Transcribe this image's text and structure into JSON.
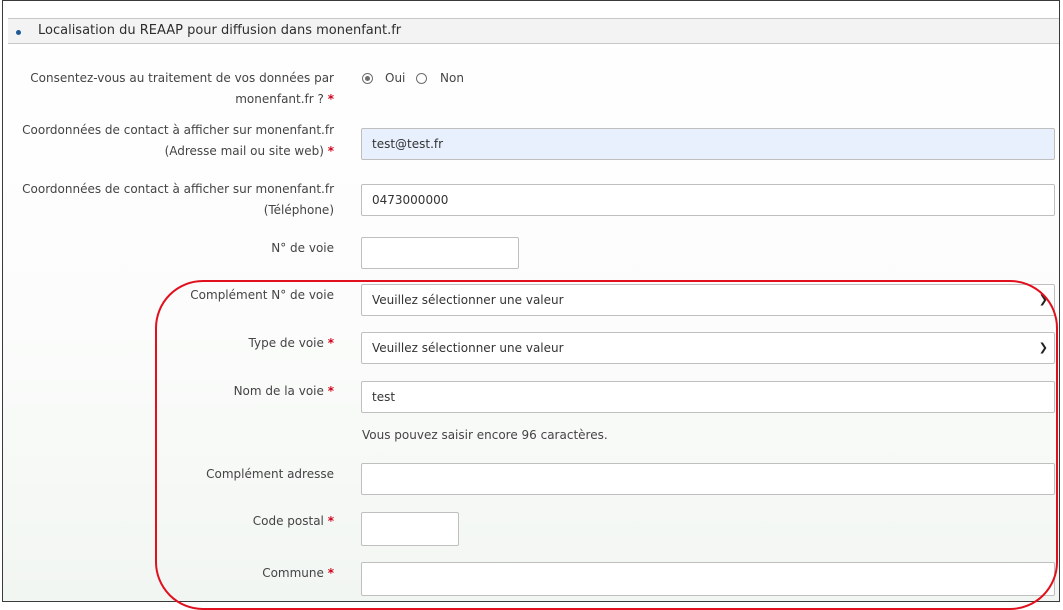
{
  "section": {
    "title": "Localisation du REAAP pour diffusion dans monenfant.fr"
  },
  "consent": {
    "label_line1": "Consentez-vous au traitement de vos données par",
    "label_line2": "monenfant.fr ?",
    "options": [
      "Oui",
      "Non"
    ],
    "selected": "Oui"
  },
  "contact_email": {
    "label_line1": "Coordonnées de contact à afficher sur monenfant.fr",
    "label_line2": "(Adresse mail ou site web)",
    "value": "test@test.fr"
  },
  "contact_phone": {
    "label_line1": "Coordonnées de contact à afficher sur monenfant.fr",
    "label_line2": "(Téléphone)",
    "value": "0473000000"
  },
  "street_number": {
    "label": "N° de voie",
    "value": ""
  },
  "street_number_complement": {
    "label": "Complément N° de voie",
    "selected": "Veuillez sélectionner une valeur"
  },
  "street_type": {
    "label": "Type de voie",
    "selected": "Veuillez sélectionner une valeur"
  },
  "street_name": {
    "label": "Nom de la voie",
    "value": "test",
    "hint": "Vous pouvez saisir encore 96 caractères."
  },
  "address_complement": {
    "label": "Complément adresse",
    "value": ""
  },
  "postal_code": {
    "label": "Code postal",
    "value": ""
  },
  "city": {
    "label": "Commune",
    "value": ""
  },
  "required_marker": "*",
  "colors": {
    "required": "#d0021b",
    "highlight": "#e0101e",
    "filled_field": "#e8f0fe",
    "bullet": "#1e5a96"
  },
  "icons": {
    "select_arrow": "chevron-down-icon"
  }
}
